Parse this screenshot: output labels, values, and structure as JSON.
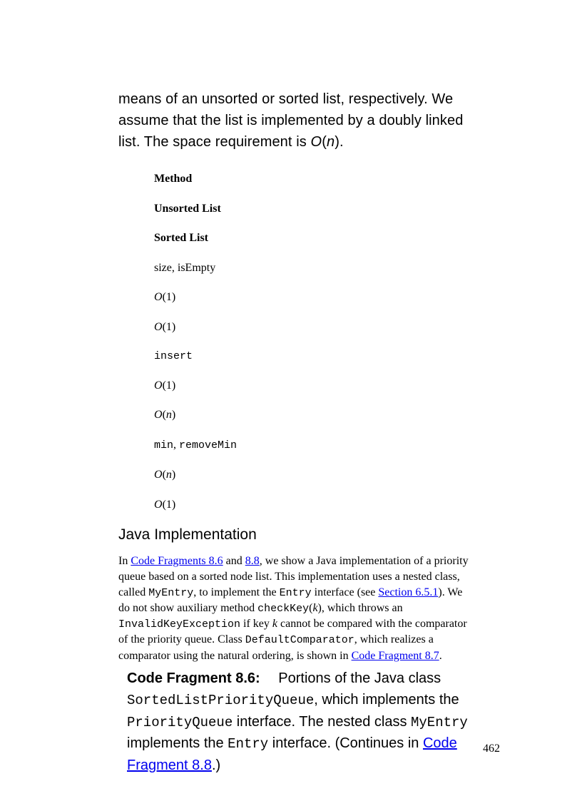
{
  "intro": {
    "text_pre": "means of an unsorted or sorted list, respectively. We assume that the list is implemented by a doubly linked list. The space requirement is ",
    "big_o": "O",
    "open": "(",
    "n": "n",
    "close": ").",
    "full_plain": "means of an unsorted or sorted list, respectively. We assume that the list is implemented by a doubly linked list. The space requirement is O(n)."
  },
  "table": {
    "hdr_method": "Method",
    "hdr_unsorted": "Unsorted List",
    "hdr_sorted": "Sorted List",
    "r1_method": "size, isEmpty",
    "r1_unsorted_O": "O",
    "r1_unsorted_arg": "(1)",
    "r1_sorted_O": "O",
    "r1_sorted_arg": "(1)",
    "r2_method": "insert",
    "r2_unsorted_O": "O",
    "r2_unsorted_arg": "(1)",
    "r2_sorted_O": "O",
    "r2_sorted_open": "(",
    "r2_sorted_n": "n",
    "r2_sorted_close": ")",
    "r3_method_a": "min",
    "r3_method_sep": ", ",
    "r3_method_b": "removeMin",
    "r3_unsorted_O": "O",
    "r3_unsorted_open": "(",
    "r3_unsorted_n": "n",
    "r3_unsorted_close": ")",
    "r3_sorted_O": "O",
    "r3_sorted_arg": "(1)"
  },
  "section_heading": "Java Implementation",
  "para": {
    "t0": "In ",
    "link1": "Code Fragments 8.6",
    "t1": " and ",
    "link2": "8.8",
    "t2": ", we show a Java implementation of a priority queue based on a sorted node list. This implementation uses a nested class, called ",
    "code1": "MyEntry",
    "t3": ", to implement the ",
    "code2": "Entry",
    "t4": " interface (see ",
    "link3": "Section 6.5.1",
    "t5": "). We do not show auxiliary method ",
    "code3": "checkKey",
    "t6": "(",
    "ital_k1": "k",
    "t7": "), which throws an ",
    "code4": "InvalidKeyException",
    "t8": " if key ",
    "ital_k2": "k",
    "t9": " cannot be compared with the comparator of the priority queue. Class ",
    "code5": "DefaultComparator",
    "t10": ", which realizes a comparator using the natural ordering, is shown in ",
    "link4": "Code Fragment 8.7",
    "t11": "."
  },
  "codefrag": {
    "label": "Code Fragment 8.6:",
    "sp1": "  ",
    "t0": "Portions of the Java class ",
    "code1": "SortedListPriorityQueue",
    "t1": ", which implements the ",
    "code2": "PriorityQueue",
    "t2": " interface. The nested class ",
    "code3": "MyEntry",
    "t3": " implements the ",
    "code4": "Entry",
    "t4": " interface. (Continues in ",
    "link1": "Code Fragment 8.8",
    "t5": ".)"
  },
  "page_number": "462"
}
